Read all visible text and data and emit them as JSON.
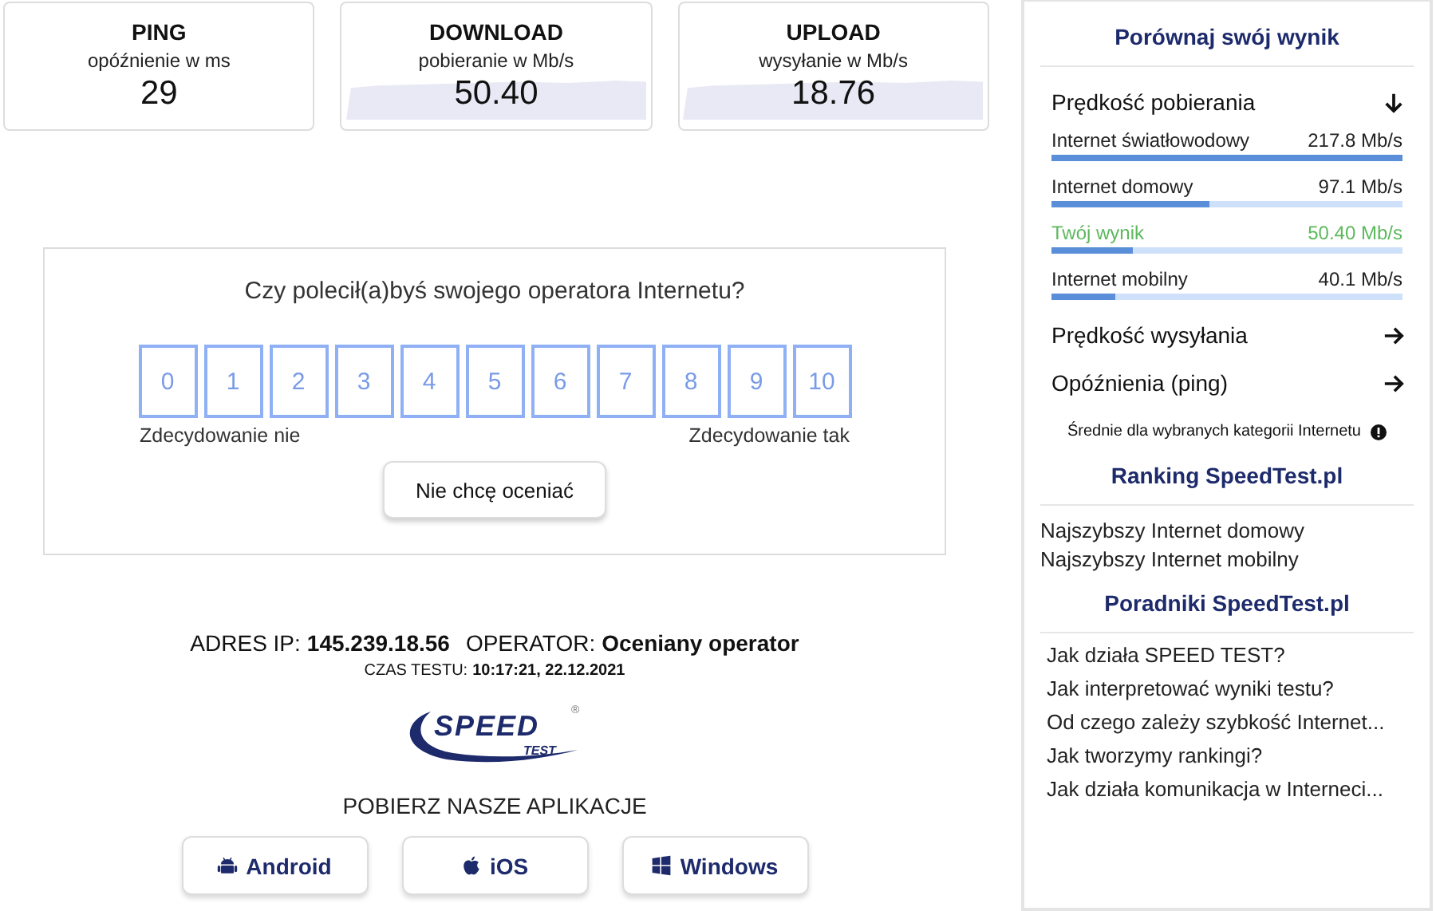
{
  "metrics": [
    {
      "title": "PING",
      "subtitle": "opóźnienie w ms",
      "value": "29",
      "graph": false
    },
    {
      "title": "DOWNLOAD",
      "subtitle": "pobieranie w Mb/s",
      "value": "50.40",
      "graph": true
    },
    {
      "title": "UPLOAD",
      "subtitle": "wysyłanie w Mb/s",
      "value": "18.76",
      "graph": true
    }
  ],
  "survey": {
    "question": "Czy polecił(a)byś swojego operatora Internetu?",
    "scale": [
      "0",
      "1",
      "2",
      "3",
      "4",
      "5",
      "6",
      "7",
      "8",
      "9",
      "10"
    ],
    "low_label": "Zdecydowanie nie",
    "high_label": "Zdecydowanie tak",
    "skip_button": "Nie chcę oceniać"
  },
  "info": {
    "ip_label": "ADRES IP:",
    "ip": "145.239.18.56",
    "operator_label": "OPERATOR:",
    "operator": "Oceniany operator",
    "time_label": "CZAS TESTU:",
    "time": "10:17:21, 22.12.2021"
  },
  "logo": {
    "main": "SPEED",
    "sub": "TEST",
    "mark": "®"
  },
  "apps": {
    "title": "POBIERZ NASZE APLIKACJE",
    "buttons": [
      {
        "label": "Android",
        "kind": "android"
      },
      {
        "label": "iOS",
        "kind": "apple"
      },
      {
        "label": "Windows",
        "kind": "windows"
      }
    ]
  },
  "sidebar": {
    "title": "Porównaj swój wynik",
    "sections": [
      {
        "label": "Prędkość pobierania",
        "expanded": true,
        "rows": [
          {
            "name": "Internet światłowodowy",
            "reading": "217.8 Mb/s",
            "level": 1.0,
            "kind": "average"
          },
          {
            "name": "Internet domowy",
            "reading": "97.1 Mb/s",
            "level": 0.45,
            "kind": "average"
          },
          {
            "name": "Twój wynik",
            "reading": "50.40 Mb/s",
            "level": 0.23,
            "kind": "own"
          },
          {
            "name": "Internet mobilny",
            "reading": "40.1 Mb/s",
            "level": 0.18,
            "kind": "average"
          }
        ]
      },
      {
        "label": "Prędkość wysyłania",
        "expanded": false
      },
      {
        "label": "Opóźnienia (ping)",
        "expanded": false
      }
    ],
    "note": "Średnie dla wybranych kategorii Internetu",
    "ranking_title": "Ranking SpeedTest.pl",
    "ranking": [
      "Najszybszy Internet domowy",
      "Najszybszy Internet mobilny"
    ],
    "guides_title": "Poradniki SpeedTest.pl",
    "guides": [
      "Jak działa SPEED TEST?",
      "Jak interpretować wyniki testu?",
      "Od czego zależy szybkość Internet...",
      "Jak tworzymy rankingi?",
      "Jak działa komunikacja w Interneci..."
    ]
  }
}
